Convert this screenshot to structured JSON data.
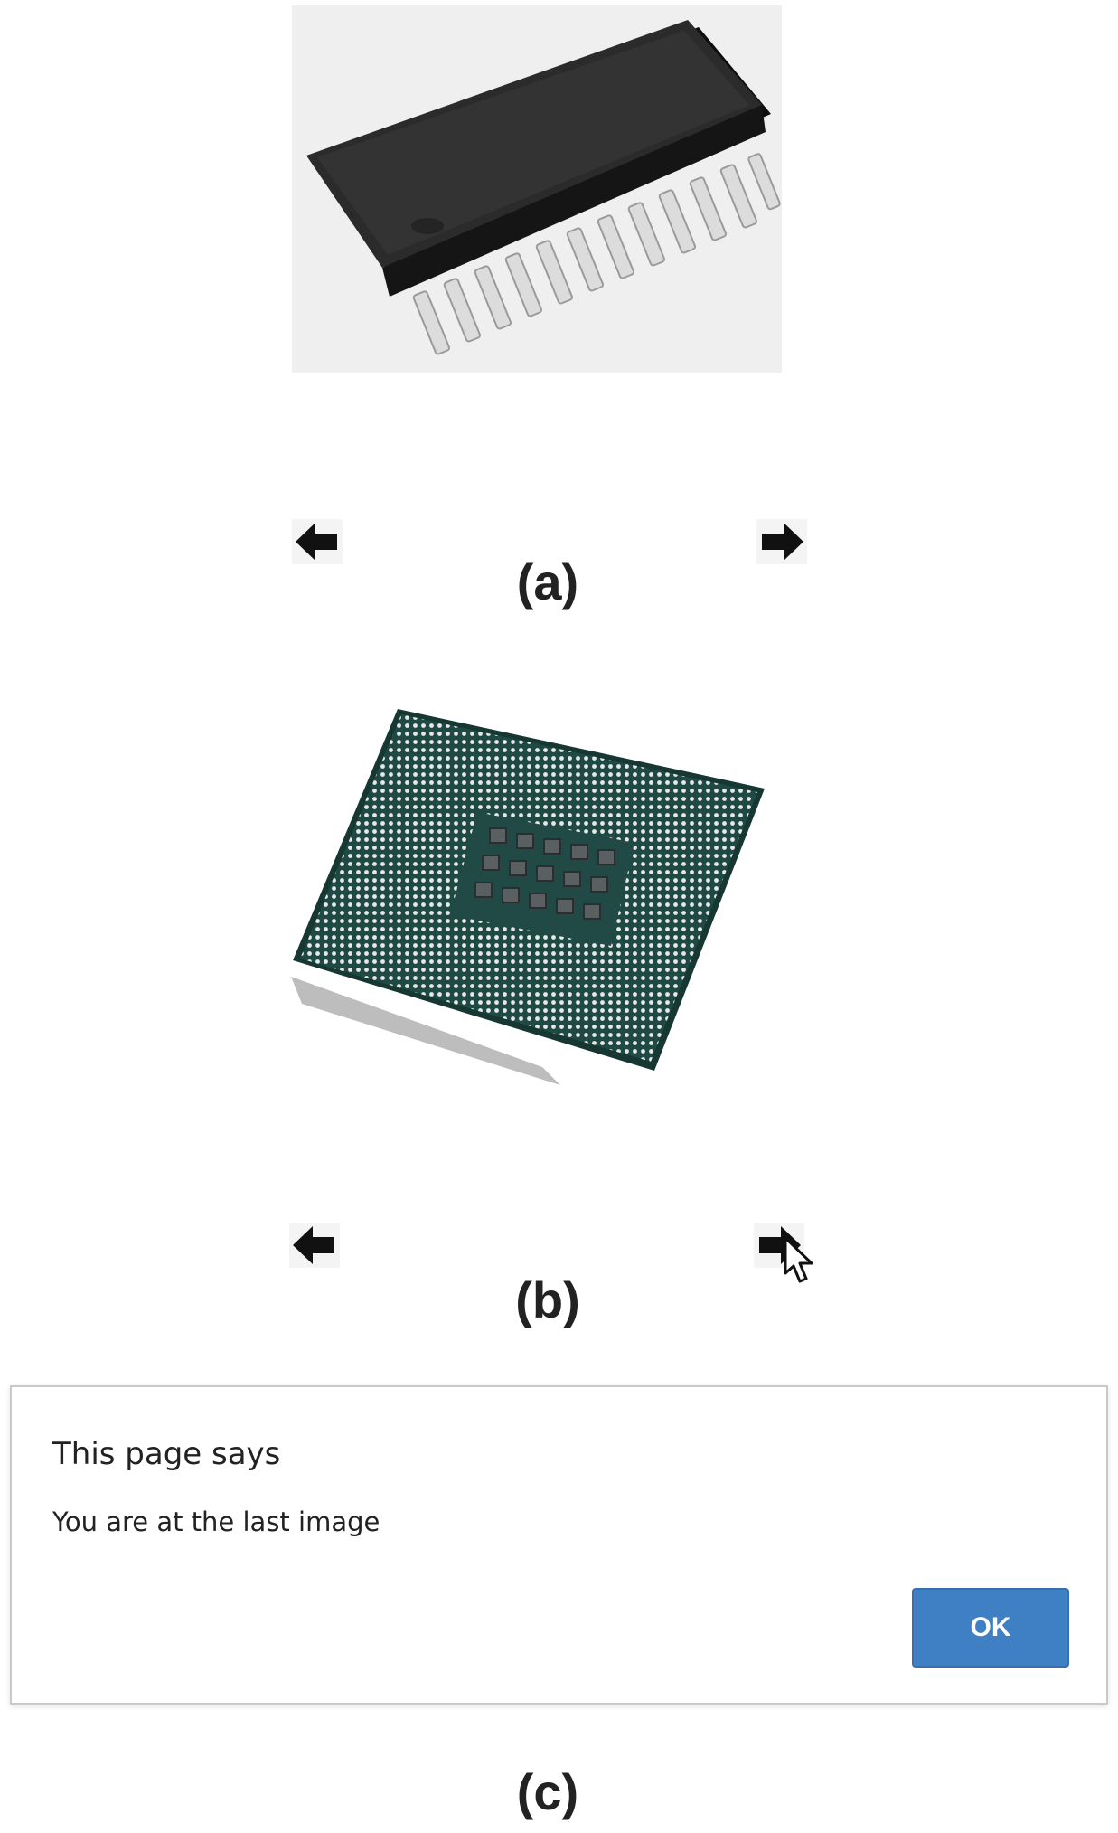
{
  "panel_a": {
    "image_icon": "soic-chip-image",
    "prev_icon": "arrow-left-icon",
    "next_icon": "arrow-right-icon",
    "caption": "(a)"
  },
  "panel_b": {
    "image_icon": "cpu-processor-image",
    "prev_icon": "arrow-left-icon",
    "next_icon": "arrow-right-icon",
    "cursor_icon": "mouse-pointer-icon",
    "caption": "(b)"
  },
  "panel_c": {
    "dialog": {
      "title": "This page says",
      "message": "You are at the last image",
      "ok_label": "OK",
      "button_color": "#3f7fc4"
    },
    "caption": "(c)"
  }
}
